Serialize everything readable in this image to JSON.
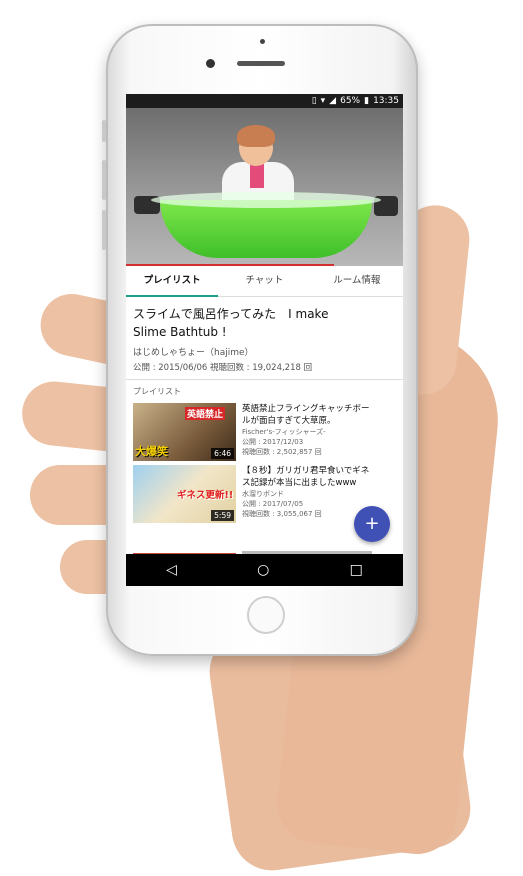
{
  "status_bar": {
    "battery": "65%",
    "time": "13:35"
  },
  "video": {
    "progress": 0.75
  },
  "tabs": [
    {
      "label": "プレイリスト"
    },
    {
      "label": "チャット"
    },
    {
      "label": "ルーム情報"
    }
  ],
  "info": {
    "title_line1": "スライムで風呂作ってみた　I make",
    "title_line2": "Slime Bathtub !",
    "channel": "はじめしゃちょー（hajime）",
    "meta": "公開 : 2015/06/06  視聴回数 : 19,024,218 回"
  },
  "playlist": {
    "header": "プレイリスト",
    "items": [
      {
        "thumb_text_a": "英語禁止",
        "thumb_text_b": "大爆笑",
        "duration": "6:46",
        "title_line1": "英語禁止フライングキャッチボー",
        "title_line2": "ルが面白すぎて大草原。",
        "channel": "Fischer's-フィッシャーズ-",
        "published": "公開 : 2017/12/03",
        "views": "視聴回数 : 2,502,857 回"
      },
      {
        "thumb_text_a": "ギネス更新!!",
        "thumb_text_b": "",
        "duration": "5:59",
        "title_line1": "【８秒】ガリガリ君早食いでギネ",
        "title_line2": "ス記録が本当に出ましたwww",
        "channel": "水溜りボンド",
        "published": "公開 : 2017/07/05",
        "views": "視聴回数 : 3,055,067 回"
      }
    ]
  },
  "fab": {
    "icon": "plus-icon",
    "glyph": "+"
  },
  "navbar": {
    "back": "◁",
    "home": "○",
    "recents": "□"
  },
  "colors": {
    "accent_tab": "#1aa08a",
    "progress": "#d32f2f",
    "fab": "#3f51b5"
  }
}
